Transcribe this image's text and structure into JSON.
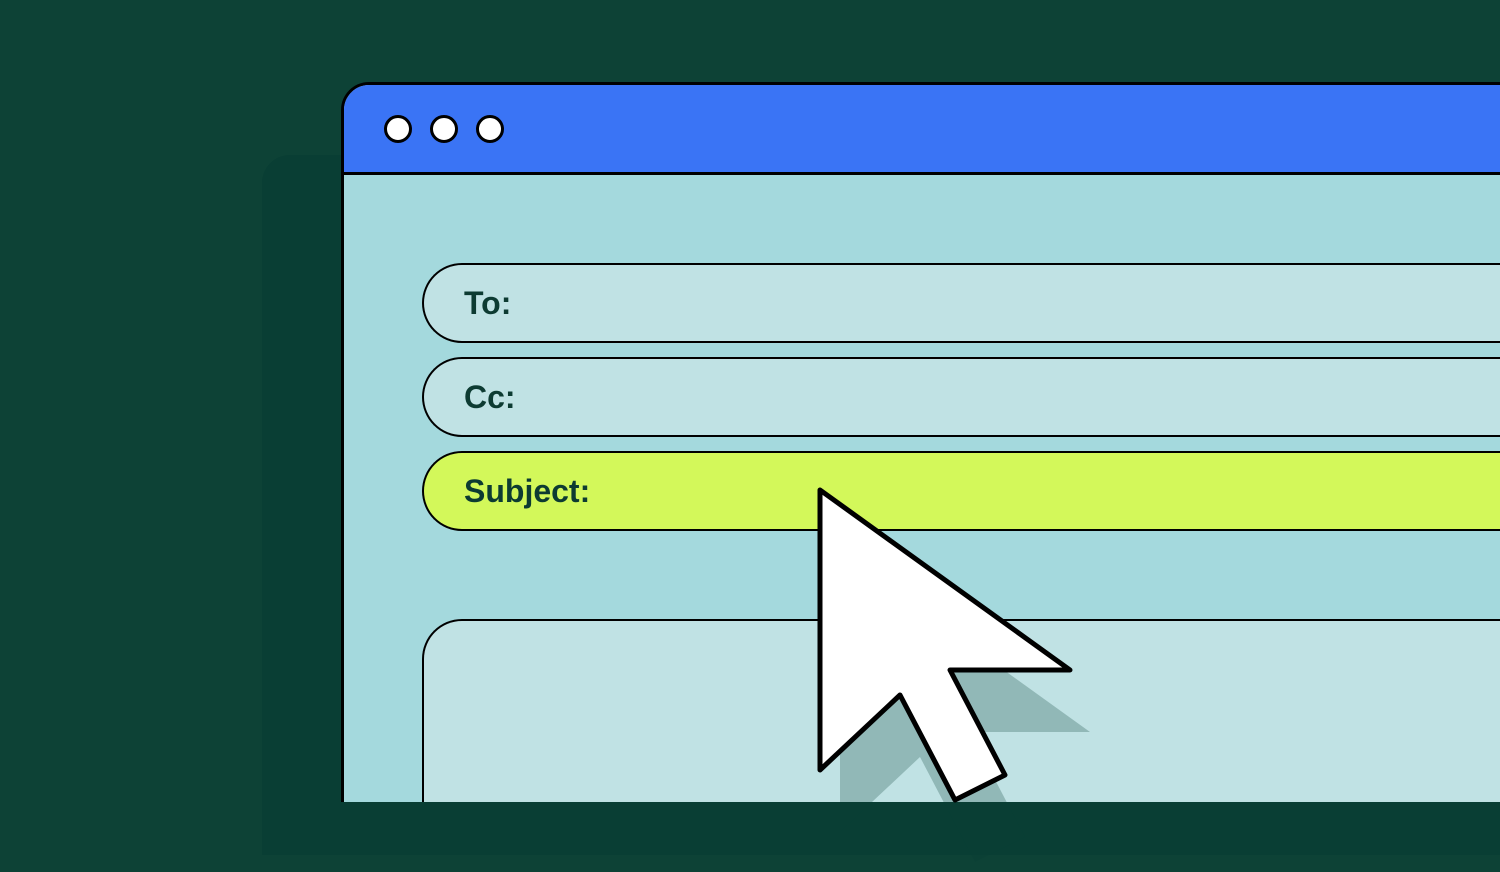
{
  "compose": {
    "fields": {
      "to_label": "To:",
      "cc_label": "Cc:",
      "subject_label": "Subject:"
    }
  },
  "colors": {
    "background": "#0d4236",
    "shadow": "#093e34",
    "titlebar": "#3a74f5",
    "window_body": "#a4d9dd",
    "field_bg": "#c0e2e4",
    "highlight": "#d3f85a",
    "text": "#0d3b32"
  },
  "icons": {
    "traffic_light": "traffic-light-dot",
    "cursor": "pointer-cursor"
  }
}
